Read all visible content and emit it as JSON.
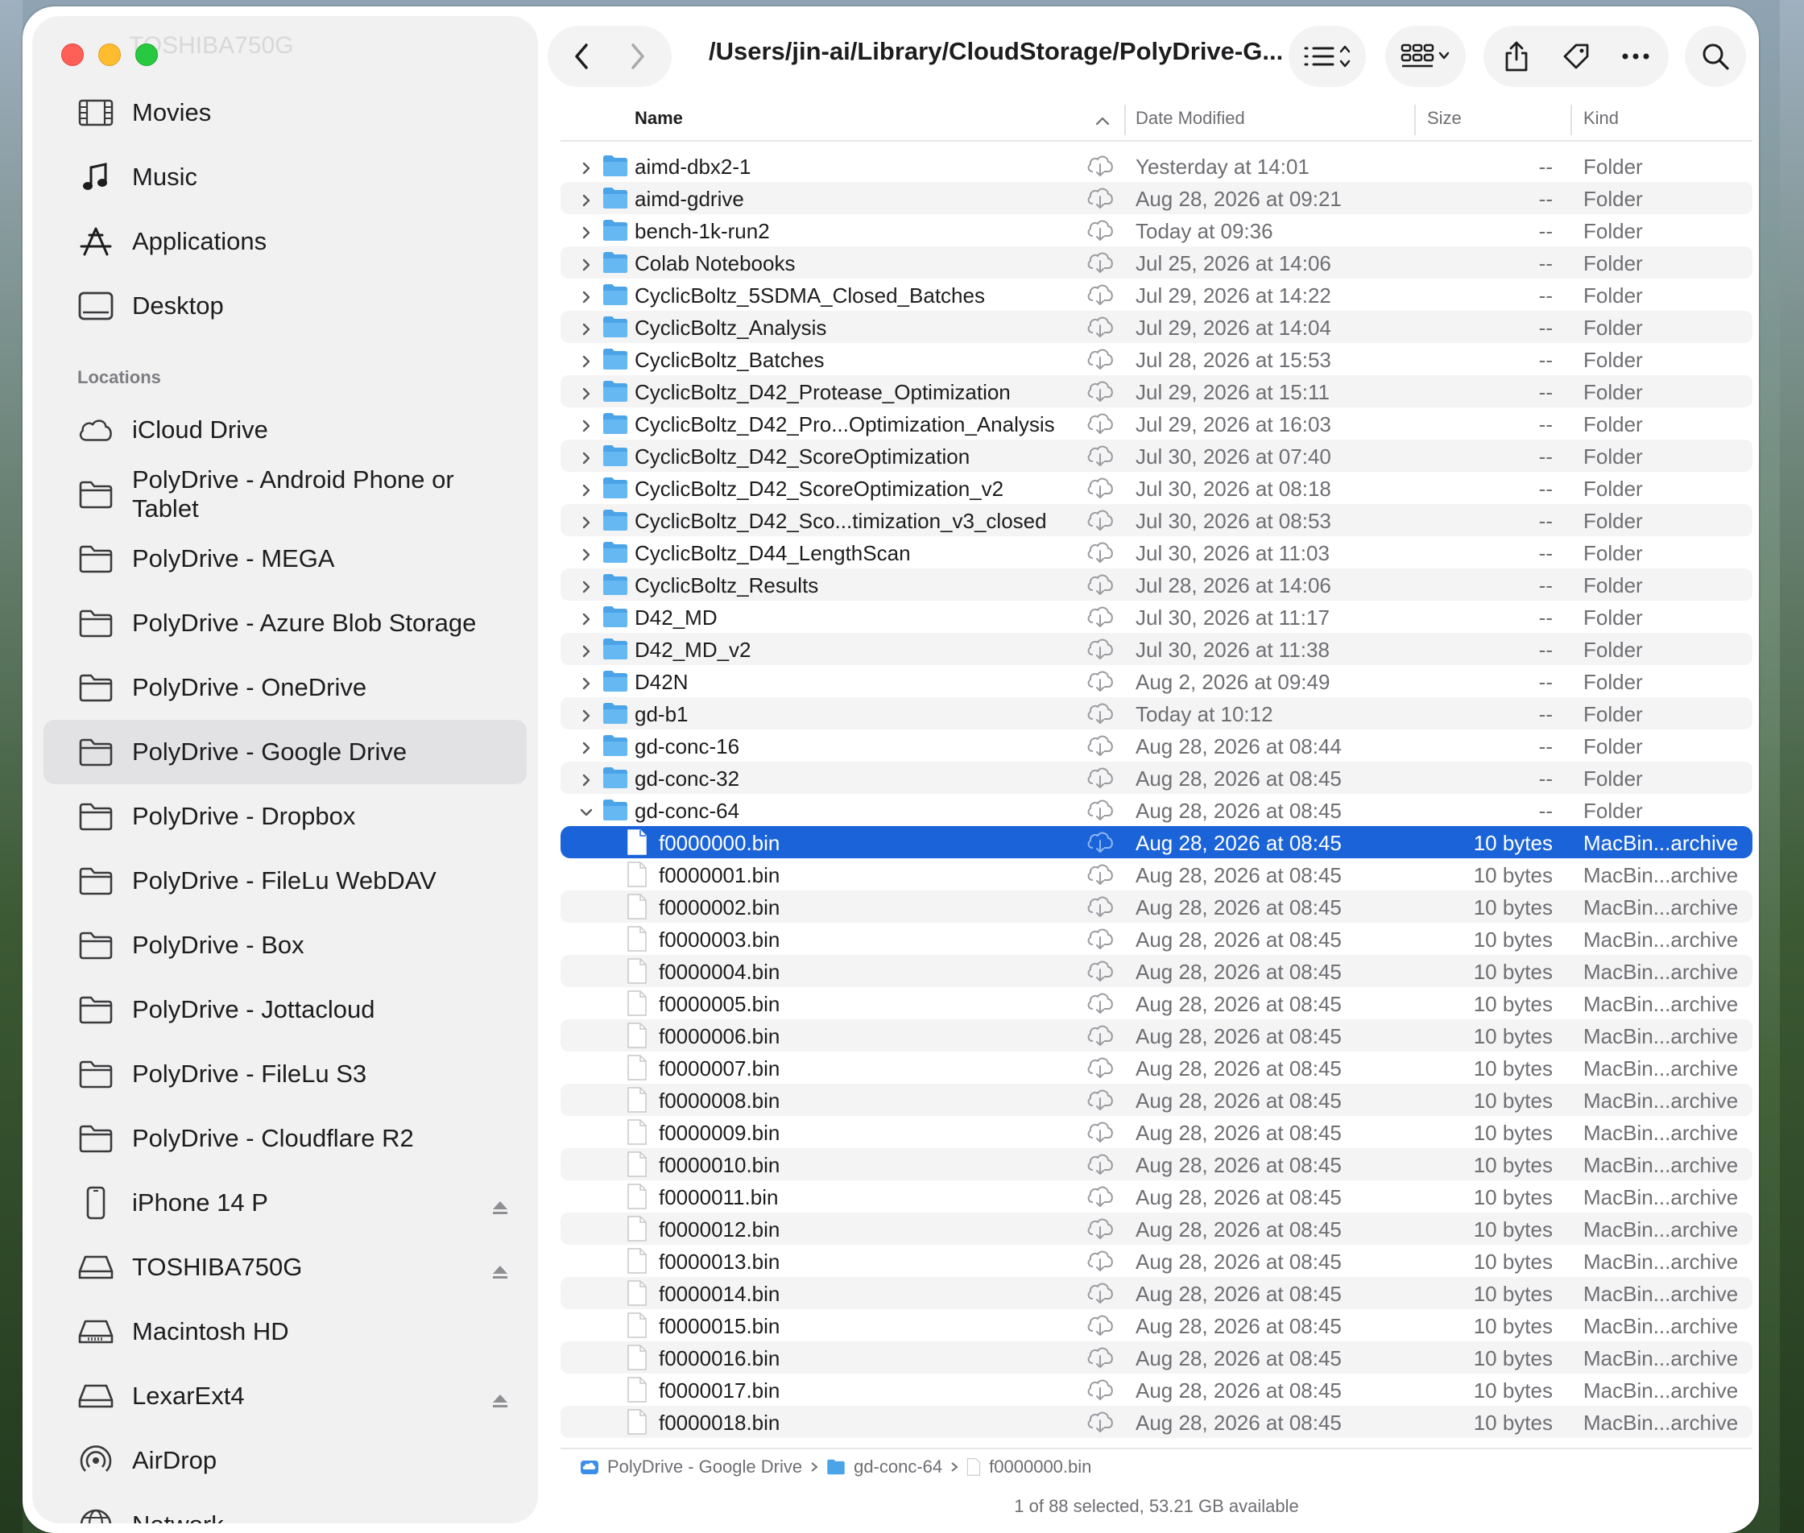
{
  "window": {
    "path_title": "/Users/jin-ai/Library/CloudStorage/PolyDrive-G...",
    "ghost_sidebar_item": "TOSHIBA750G"
  },
  "toolbar": {
    "back_icon": "chevron-left-icon",
    "forward_icon": "chevron-right-icon",
    "list_view_icon": "list-view-icon",
    "group_icon": "grid-view-icon",
    "share_icon": "share-icon",
    "tag_icon": "tag-icon",
    "more_icon": "ellipsis-icon",
    "search_icon": "search-icon"
  },
  "sidebar": {
    "favorites": [
      {
        "label": "Movies",
        "icon": "film-icon"
      },
      {
        "label": "Music",
        "icon": "music-note-icon"
      },
      {
        "label": "Applications",
        "icon": "applications-icon"
      },
      {
        "label": "Desktop",
        "icon": "desktop-icon"
      }
    ],
    "locations_heading": "Locations",
    "locations": [
      {
        "label": "iCloud Drive",
        "icon": "icloud-icon"
      },
      {
        "label": "PolyDrive - Android Phone or Tablet",
        "icon": "folder-icon"
      },
      {
        "label": "PolyDrive - MEGA",
        "icon": "folder-icon"
      },
      {
        "label": "PolyDrive - Azure Blob Storage",
        "icon": "folder-icon"
      },
      {
        "label": "PolyDrive - OneDrive",
        "icon": "folder-icon"
      },
      {
        "label": "PolyDrive - Google Drive",
        "icon": "folder-icon",
        "selected": true
      },
      {
        "label": "PolyDrive - Dropbox",
        "icon": "folder-icon"
      },
      {
        "label": "PolyDrive - FileLu WebDAV",
        "icon": "folder-icon"
      },
      {
        "label": "PolyDrive - Box",
        "icon": "folder-icon"
      },
      {
        "label": "PolyDrive - Jottacloud",
        "icon": "folder-icon"
      },
      {
        "label": "PolyDrive - FileLu S3",
        "icon": "folder-icon"
      },
      {
        "label": "PolyDrive - Cloudflare R2",
        "icon": "folder-icon"
      },
      {
        "label": "iPhone 14 P",
        "icon": "iphone-icon",
        "eject": true
      },
      {
        "label": "TOSHIBA750G",
        "icon": "external-drive-icon",
        "eject": true
      },
      {
        "label": "Macintosh HD",
        "icon": "internal-drive-icon"
      },
      {
        "label": "LexarExt4",
        "icon": "external-drive-icon",
        "eject": true
      },
      {
        "label": "AirDrop",
        "icon": "airdrop-icon"
      },
      {
        "label": "Network",
        "icon": "network-globe-icon"
      }
    ]
  },
  "columns": {
    "name": "Name",
    "date": "Date Modified",
    "size": "Size",
    "kind": "Kind"
  },
  "rows": [
    {
      "name": "aimd-dbx2-1",
      "date": "Yesterday at 14:01",
      "size": "--",
      "kind": "Folder",
      "type": "folder"
    },
    {
      "name": "aimd-gdrive",
      "date": "Aug 28, 2026 at 09:21",
      "size": "--",
      "kind": "Folder",
      "type": "folder"
    },
    {
      "name": "bench-1k-run2",
      "date": "Today at 09:36",
      "size": "--",
      "kind": "Folder",
      "type": "folder"
    },
    {
      "name": "Colab Notebooks",
      "date": "Jul 25, 2026 at 14:06",
      "size": "--",
      "kind": "Folder",
      "type": "folder"
    },
    {
      "name": "CyclicBoltz_5SDMA_Closed_Batches",
      "date": "Jul 29, 2026 at 14:22",
      "size": "--",
      "kind": "Folder",
      "type": "folder"
    },
    {
      "name": "CyclicBoltz_Analysis",
      "date": "Jul 29, 2026 at 14:04",
      "size": "--",
      "kind": "Folder",
      "type": "folder"
    },
    {
      "name": "CyclicBoltz_Batches",
      "date": "Jul 28, 2026 at 15:53",
      "size": "--",
      "kind": "Folder",
      "type": "folder"
    },
    {
      "name": "CyclicBoltz_D42_Protease_Optimization",
      "date": "Jul 29, 2026 at 15:11",
      "size": "--",
      "kind": "Folder",
      "type": "folder"
    },
    {
      "name": "CyclicBoltz_D42_Pro...Optimization_Analysis",
      "date": "Jul 29, 2026 at 16:03",
      "size": "--",
      "kind": "Folder",
      "type": "folder"
    },
    {
      "name": "CyclicBoltz_D42_ScoreOptimization",
      "date": "Jul 30, 2026 at 07:40",
      "size": "--",
      "kind": "Folder",
      "type": "folder"
    },
    {
      "name": "CyclicBoltz_D42_ScoreOptimization_v2",
      "date": "Jul 30, 2026 at 08:18",
      "size": "--",
      "kind": "Folder",
      "type": "folder"
    },
    {
      "name": "CyclicBoltz_D42_Sco...timization_v3_closed",
      "date": "Jul 30, 2026 at 08:53",
      "size": "--",
      "kind": "Folder",
      "type": "folder"
    },
    {
      "name": "CyclicBoltz_D44_LengthScan",
      "date": "Jul 30, 2026 at 11:03",
      "size": "--",
      "kind": "Folder",
      "type": "folder"
    },
    {
      "name": "CyclicBoltz_Results",
      "date": "Jul 28, 2026 at 14:06",
      "size": "--",
      "kind": "Folder",
      "type": "folder"
    },
    {
      "name": "D42_MD",
      "date": "Jul 30, 2026 at 11:17",
      "size": "--",
      "kind": "Folder",
      "type": "folder"
    },
    {
      "name": "D42_MD_v2",
      "date": "Jul 30, 2026 at 11:38",
      "size": "--",
      "kind": "Folder",
      "type": "folder"
    },
    {
      "name": "D42N",
      "date": "Aug 2, 2026 at 09:49",
      "size": "--",
      "kind": "Folder",
      "type": "folder"
    },
    {
      "name": "gd-b1",
      "date": "Today at 10:12",
      "size": "--",
      "kind": "Folder",
      "type": "folder"
    },
    {
      "name": "gd-conc-16",
      "date": "Aug 28, 2026 at 08:44",
      "size": "--",
      "kind": "Folder",
      "type": "folder"
    },
    {
      "name": "gd-conc-32",
      "date": "Aug 28, 2026 at 08:45",
      "size": "--",
      "kind": "Folder",
      "type": "folder"
    },
    {
      "name": "gd-conc-64",
      "date": "Aug 28, 2026 at 08:45",
      "size": "--",
      "kind": "Folder",
      "type": "folder",
      "expanded": true
    },
    {
      "name": "f0000000.bin",
      "date": "Aug 28, 2026 at 08:45",
      "size": "10 bytes",
      "kind": "MacBin...archive",
      "type": "file",
      "selected": true
    },
    {
      "name": "f0000001.bin",
      "date": "Aug 28, 2026 at 08:45",
      "size": "10 bytes",
      "kind": "MacBin...archive",
      "type": "file"
    },
    {
      "name": "f0000002.bin",
      "date": "Aug 28, 2026 at 08:45",
      "size": "10 bytes",
      "kind": "MacBin...archive",
      "type": "file"
    },
    {
      "name": "f0000003.bin",
      "date": "Aug 28, 2026 at 08:45",
      "size": "10 bytes",
      "kind": "MacBin...archive",
      "type": "file"
    },
    {
      "name": "f0000004.bin",
      "date": "Aug 28, 2026 at 08:45",
      "size": "10 bytes",
      "kind": "MacBin...archive",
      "type": "file"
    },
    {
      "name": "f0000005.bin",
      "date": "Aug 28, 2026 at 08:45",
      "size": "10 bytes",
      "kind": "MacBin...archive",
      "type": "file"
    },
    {
      "name": "f0000006.bin",
      "date": "Aug 28, 2026 at 08:45",
      "size": "10 bytes",
      "kind": "MacBin...archive",
      "type": "file"
    },
    {
      "name": "f0000007.bin",
      "date": "Aug 28, 2026 at 08:45",
      "size": "10 bytes",
      "kind": "MacBin...archive",
      "type": "file"
    },
    {
      "name": "f0000008.bin",
      "date": "Aug 28, 2026 at 08:45",
      "size": "10 bytes",
      "kind": "MacBin...archive",
      "type": "file"
    },
    {
      "name": "f0000009.bin",
      "date": "Aug 28, 2026 at 08:45",
      "size": "10 bytes",
      "kind": "MacBin...archive",
      "type": "file"
    },
    {
      "name": "f0000010.bin",
      "date": "Aug 28, 2026 at 08:45",
      "size": "10 bytes",
      "kind": "MacBin...archive",
      "type": "file"
    },
    {
      "name": "f0000011.bin",
      "date": "Aug 28, 2026 at 08:45",
      "size": "10 bytes",
      "kind": "MacBin...archive",
      "type": "file"
    },
    {
      "name": "f0000012.bin",
      "date": "Aug 28, 2026 at 08:45",
      "size": "10 bytes",
      "kind": "MacBin...archive",
      "type": "file"
    },
    {
      "name": "f0000013.bin",
      "date": "Aug 28, 2026 at 08:45",
      "size": "10 bytes",
      "kind": "MacBin...archive",
      "type": "file"
    },
    {
      "name": "f0000014.bin",
      "date": "Aug 28, 2026 at 08:45",
      "size": "10 bytes",
      "kind": "MacBin...archive",
      "type": "file"
    },
    {
      "name": "f0000015.bin",
      "date": "Aug 28, 2026 at 08:45",
      "size": "10 bytes",
      "kind": "MacBin...archive",
      "type": "file"
    },
    {
      "name": "f0000016.bin",
      "date": "Aug 28, 2026 at 08:45",
      "size": "10 bytes",
      "kind": "MacBin...archive",
      "type": "file"
    },
    {
      "name": "f0000017.bin",
      "date": "Aug 28, 2026 at 08:45",
      "size": "10 bytes",
      "kind": "MacBin...archive",
      "type": "file"
    },
    {
      "name": "f0000018.bin",
      "date": "Aug 28, 2026 at 08:45",
      "size": "10 bytes",
      "kind": "MacBin...archive",
      "type": "file"
    }
  ],
  "pathbar": {
    "segments": [
      "PolyDrive - Google Drive",
      "gd-conc-64",
      "f0000000.bin"
    ]
  },
  "status": "1 of 88 selected, 53.21 GB available",
  "colors": {
    "selection": "#1a63d8",
    "folder": "#4ba3e8"
  }
}
